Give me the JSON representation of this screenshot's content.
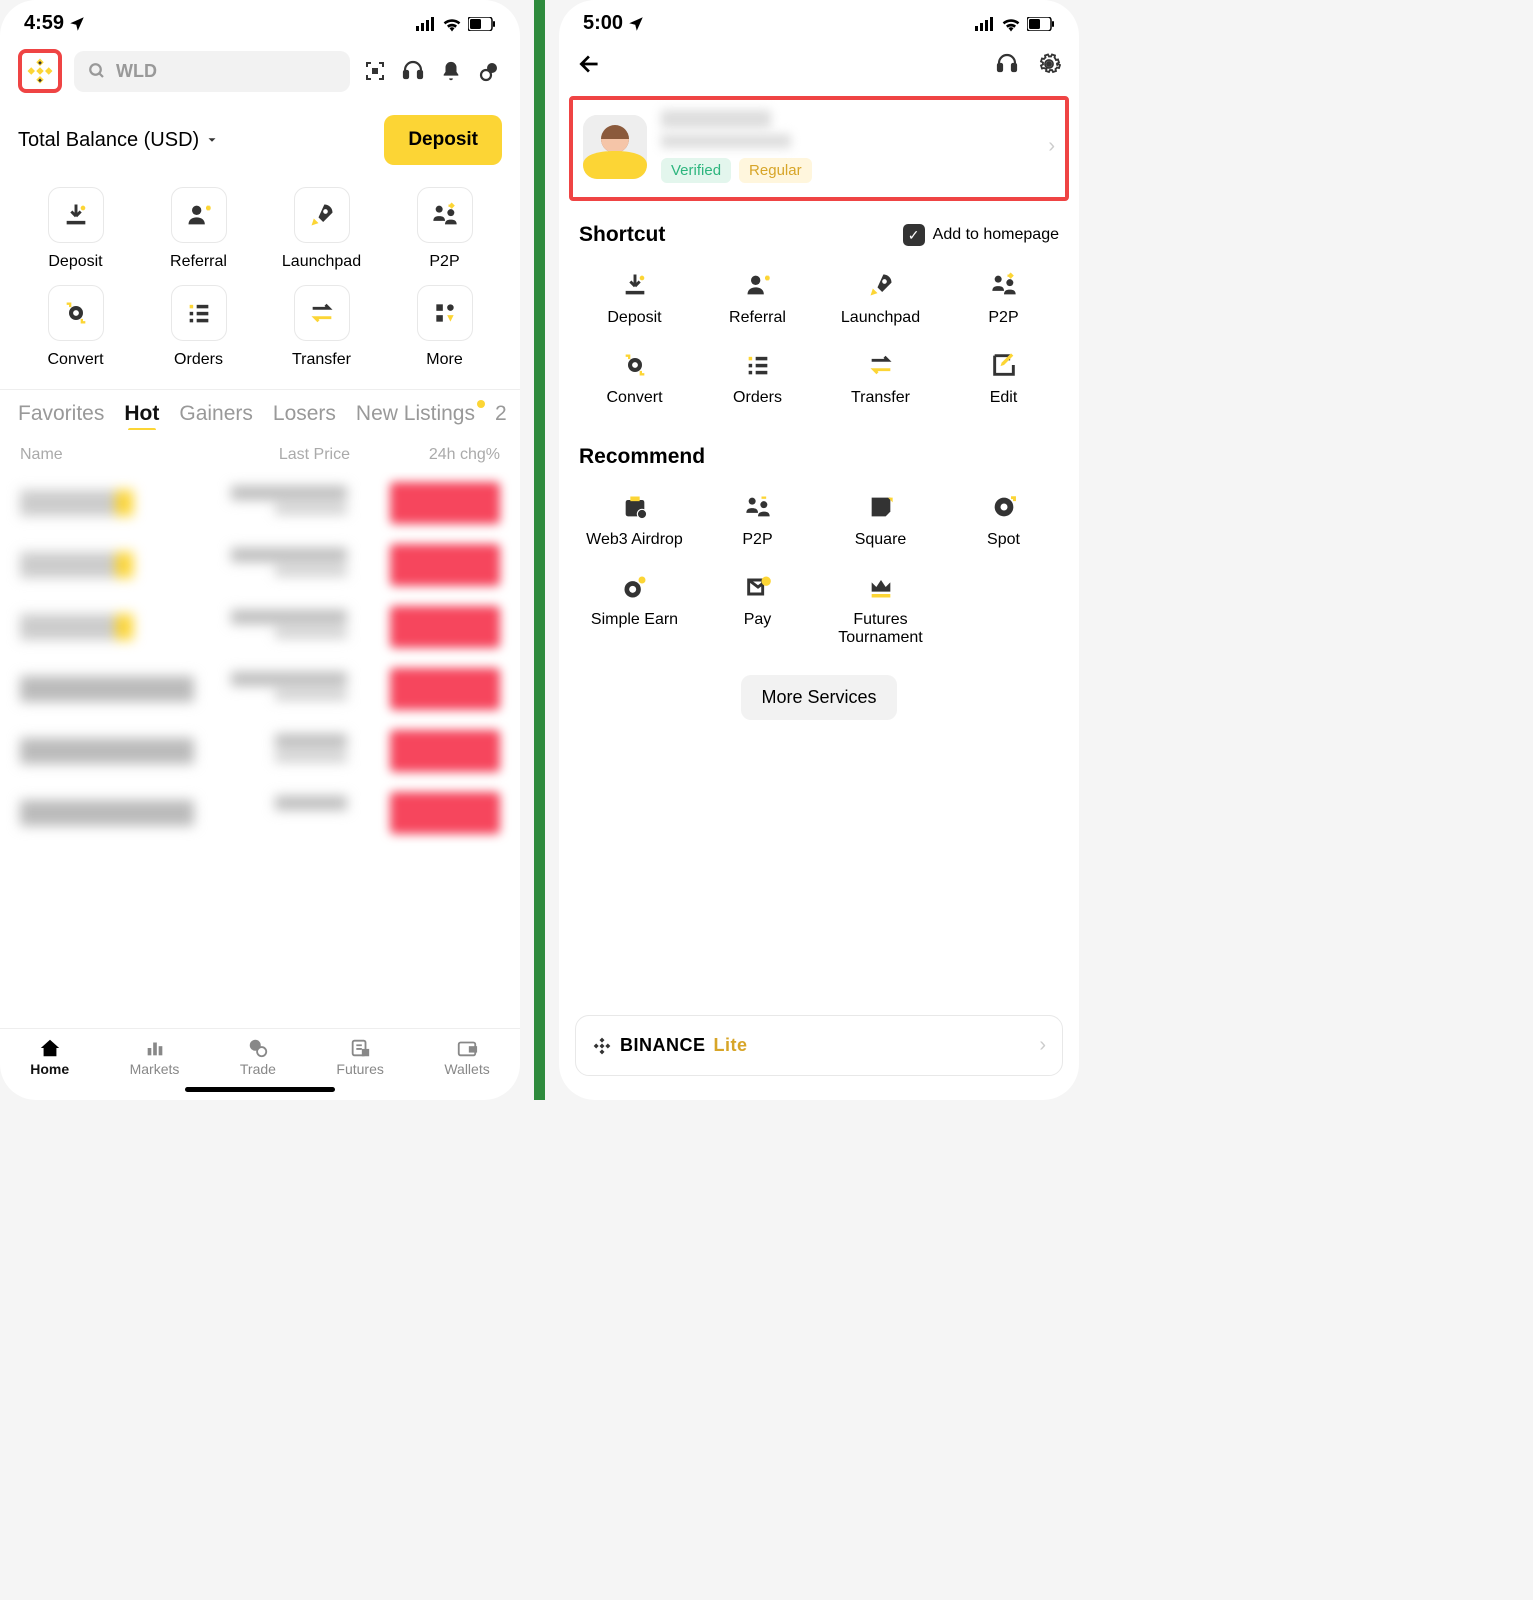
{
  "phone1": {
    "status_time": "4:59",
    "search_placeholder": "WLD",
    "balance_label": "Total Balance (USD)",
    "deposit_btn": "Deposit",
    "shortcuts": [
      "Deposit",
      "Referral",
      "Launchpad",
      "P2P",
      "Convert",
      "Orders",
      "Transfer",
      "More"
    ],
    "tabs": [
      "Favorites",
      "Hot",
      "Gainers",
      "Losers",
      "New Listings"
    ],
    "tabs_overflow": "2",
    "list_headers": {
      "name": "Name",
      "price": "Last Price",
      "chg": "24h chg%"
    },
    "bottom_nav": [
      "Home",
      "Markets",
      "Trade",
      "Futures",
      "Wallets"
    ]
  },
  "phone2": {
    "status_time": "5:00",
    "badges": {
      "verified": "Verified",
      "regular": "Regular"
    },
    "shortcut_title": "Shortcut",
    "add_homepage": "Add to homepage",
    "shortcuts": [
      "Deposit",
      "Referral",
      "Launchpad",
      "P2P",
      "Convert",
      "Orders",
      "Transfer",
      "Edit"
    ],
    "recommend_title": "Recommend",
    "recommend": [
      "Web3 Airdrop",
      "P2P",
      "Square",
      "Spot",
      "Simple Earn",
      "Pay",
      "Futures Tournament"
    ],
    "more_services": "More Services",
    "lite_brand": "BINANCE",
    "lite_label": "Lite"
  }
}
